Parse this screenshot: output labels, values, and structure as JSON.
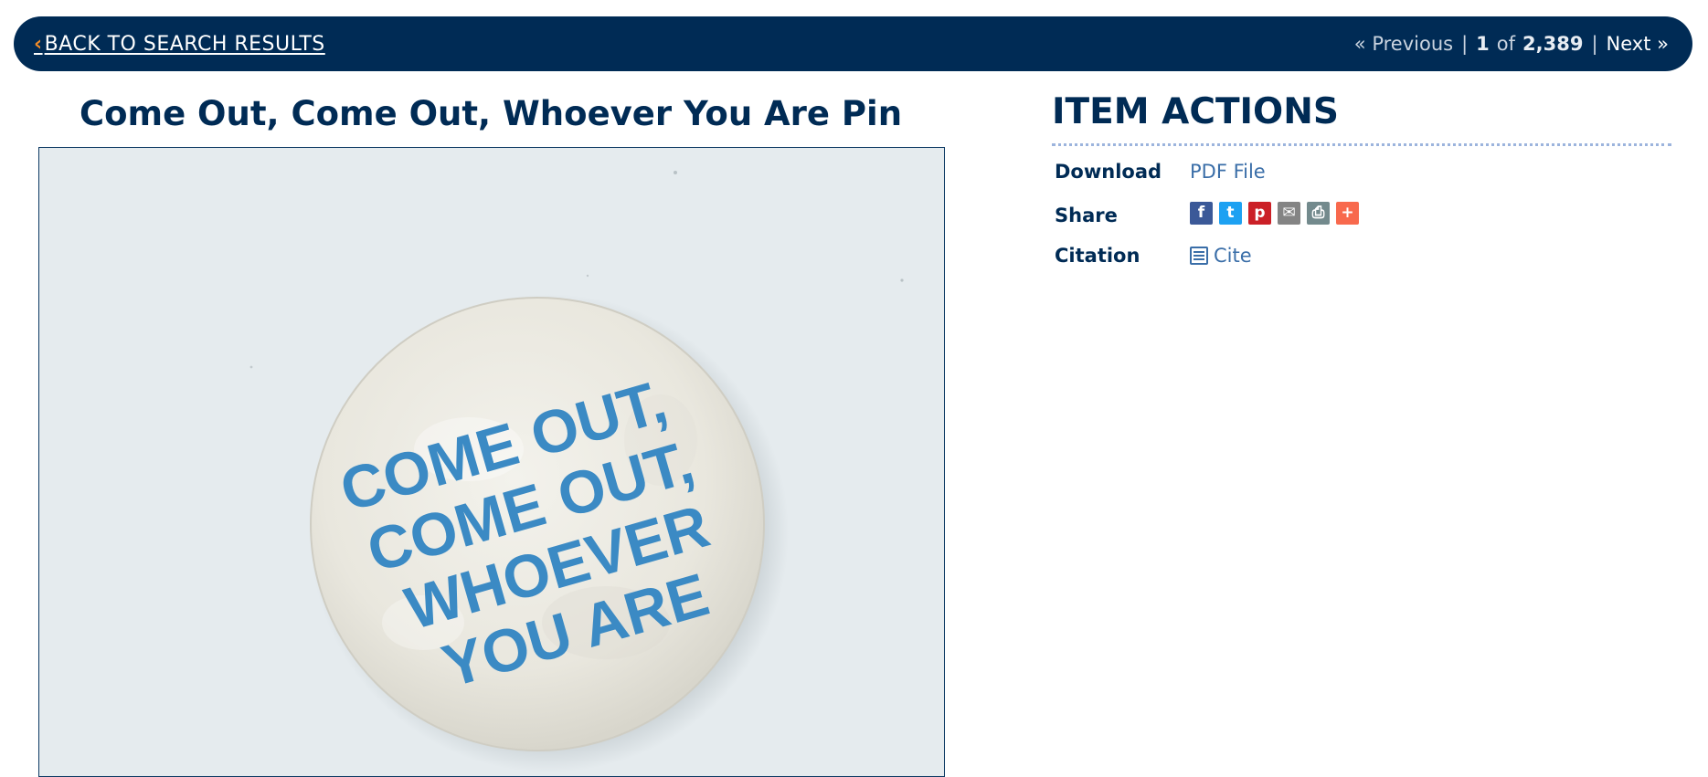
{
  "nav": {
    "back_label": "BACK TO SEARCH RESULTS",
    "prev_label": "« Previous",
    "current": "1",
    "of_label": "of",
    "total": "2,389",
    "next_label": "Next »",
    "separator": "|"
  },
  "item": {
    "title": "Come Out, Come Out, Whoever You Are Pin",
    "pin_text": [
      "COME OUT,",
      "COME OUT,",
      "WHOEVER",
      "YOU ARE"
    ]
  },
  "actions": {
    "heading": "ITEM ACTIONS",
    "download_label": "Download",
    "download_link": "PDF File",
    "share_label": "Share",
    "share_buttons": [
      {
        "name": "facebook",
        "glyph": "f",
        "color": "#3b5998"
      },
      {
        "name": "twitter",
        "glyph": "t",
        "color": "#1da1f2"
      },
      {
        "name": "pinterest",
        "glyph": "p",
        "color": "#cb2027"
      },
      {
        "name": "email",
        "glyph": "✉",
        "color": "#848484"
      },
      {
        "name": "print",
        "glyph": "⎙",
        "color": "#738a8d"
      },
      {
        "name": "more",
        "glyph": "+",
        "color": "#f8694d"
      }
    ],
    "citation_label": "Citation",
    "cite_link": "Cite"
  },
  "colors": {
    "navy": "#002b55",
    "accent_orange": "#f28c28",
    "link_blue": "#3a6ea8",
    "pin_text_blue": "#3b8ac4"
  }
}
